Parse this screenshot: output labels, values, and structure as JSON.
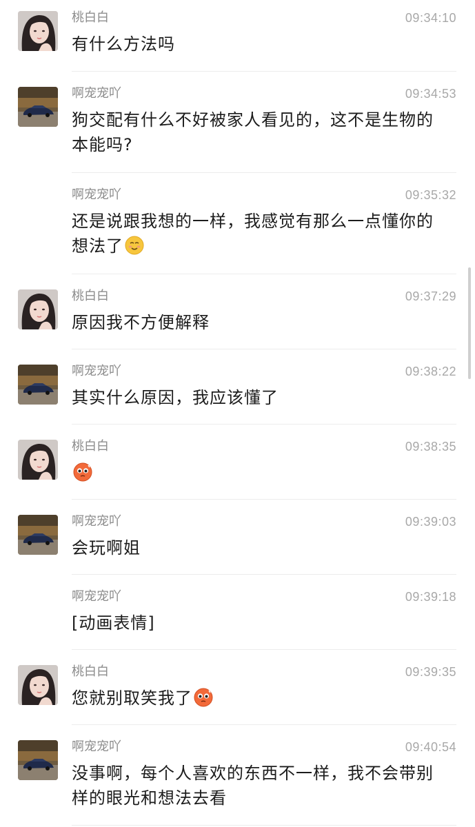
{
  "messages": [
    {
      "sender": "桃白白",
      "avatar": "girl",
      "time": "09:34:10",
      "lines": [
        "有什么方法吗"
      ]
    },
    {
      "sender": "啊宠宠吖",
      "avatar": "car",
      "time": "09:34:53",
      "lines": [
        "狗交配有什么不好被家人看见的，这不是生物的",
        "本能吗?"
      ]
    },
    {
      "sender": "啊宠宠吖",
      "avatar": "none",
      "time": "09:35:32",
      "lines": [
        "还是说跟我想的一样，我感觉有那么一点懂你的",
        "想法了"
      ],
      "emoji": "smile-face-emoji"
    },
    {
      "sender": "桃白白",
      "avatar": "girl",
      "time": "09:37:29",
      "lines": [
        "原因我不方便解释"
      ]
    },
    {
      "sender": "啊宠宠吖",
      "avatar": "car",
      "time": "09:38:22",
      "lines": [
        "其实什么原因，我应该懂了"
      ]
    },
    {
      "sender": "桃白白",
      "avatar": "girl",
      "time": "09:38:35",
      "lines": [
        ""
      ],
      "emoji": "blush-face-emoji"
    },
    {
      "sender": "啊宠宠吖",
      "avatar": "car",
      "time": "09:39:03",
      "lines": [
        "会玩啊姐"
      ]
    },
    {
      "sender": "啊宠宠吖",
      "avatar": "none",
      "time": "09:39:18",
      "lines": [
        "[动画表情]"
      ]
    },
    {
      "sender": "桃白白",
      "avatar": "girl",
      "time": "09:39:35",
      "lines": [
        "您就别取笑我了"
      ],
      "emoji": "blush-face-emoji"
    },
    {
      "sender": "啊宠宠吖",
      "avatar": "car",
      "time": "09:40:54",
      "lines": [
        "没事啊，每个人喜欢的东西不一样，我不会带别",
        "样的眼光和想法去看"
      ]
    }
  ]
}
